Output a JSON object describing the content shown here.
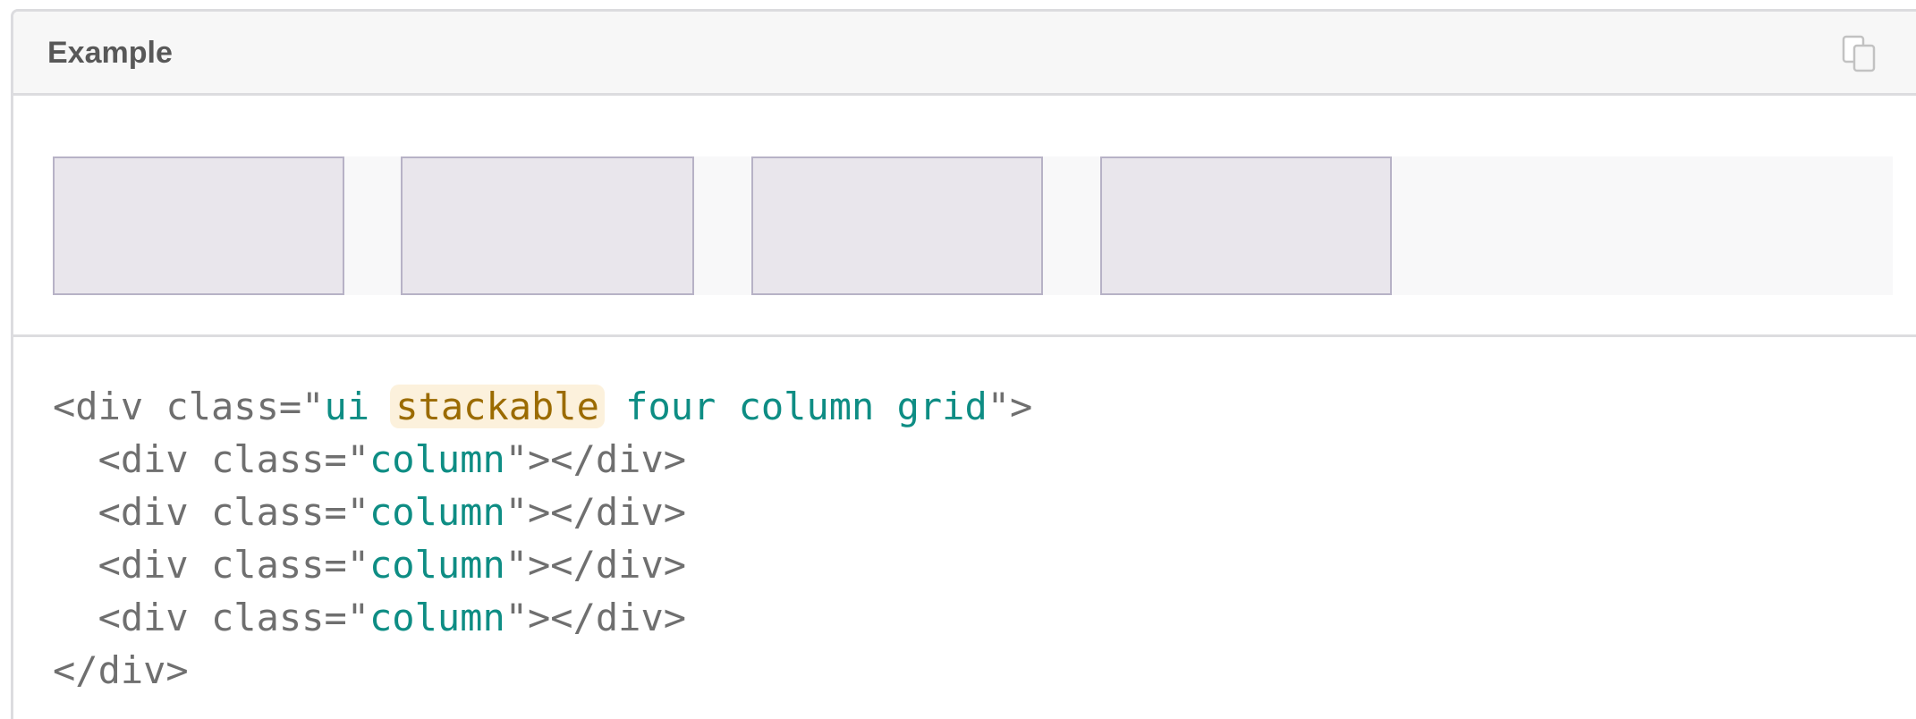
{
  "header": {
    "title": "Example",
    "copy_icon": "copy-icon"
  },
  "preview": {
    "column_count": 4
  },
  "code": {
    "lines": [
      {
        "indent": "",
        "tag_open": "<div class=\"",
        "value_before": "ui ",
        "value_highlight": "stackable",
        "value_after": " four column grid",
        "tag_close": "\">"
      },
      {
        "indent": "  ",
        "tag_open": "<div class=\"",
        "value": "column",
        "tag_close": "\"></div>"
      },
      {
        "indent": "  ",
        "tag_open": "<div class=\"",
        "value": "column",
        "tag_close": "\"></div>"
      },
      {
        "indent": "  ",
        "tag_open": "<div class=\"",
        "value": "column",
        "tag_close": "\"></div>"
      },
      {
        "indent": "  ",
        "tag_open": "<div class=\"",
        "value": "column",
        "tag_close": "\"></div>"
      },
      {
        "indent": "",
        "text": "</div>"
      }
    ]
  },
  "colors": {
    "header_bg": "#f7f7f7",
    "border": "#dcdcdf",
    "column_fill": "#e9e6ec",
    "column_border": "#b7b2c6",
    "code_text": "#6f6f6f",
    "code_value": "#0e8d84",
    "highlight_bg": "#fcf1dc",
    "highlight_text": "#9b6b00"
  }
}
